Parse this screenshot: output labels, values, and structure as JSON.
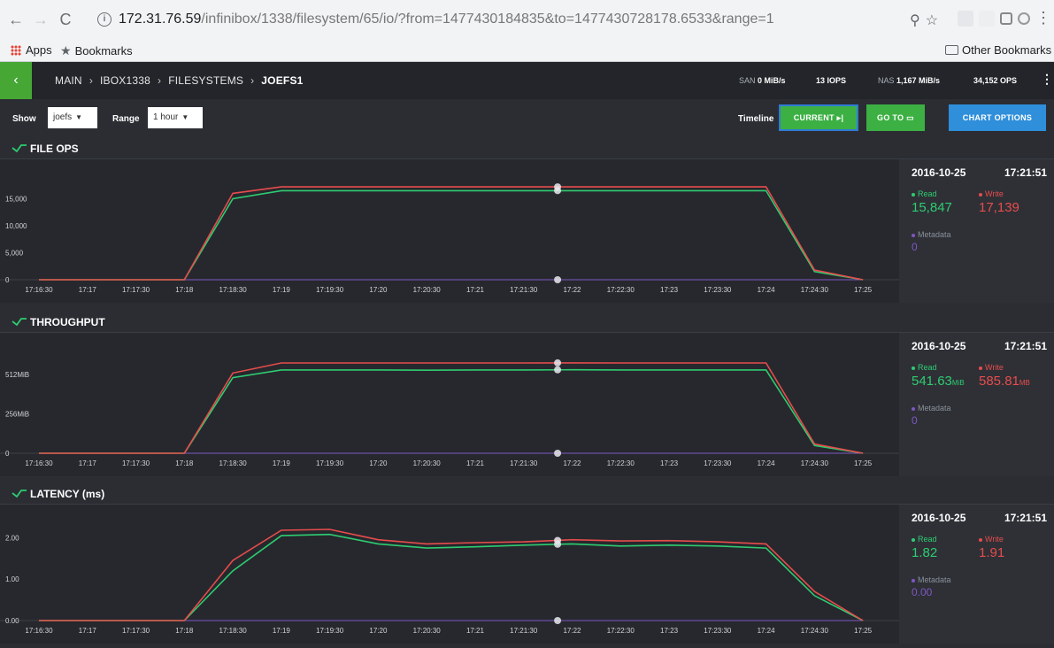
{
  "browser": {
    "url_host": "172.31.76.59",
    "url_path": "/infinibox/1338/filesystem/65/io/?from=1477430184835&to=1477430728178.6533&range=1",
    "bookmarks": {
      "apps": "Apps",
      "bookmarks": "Bookmarks",
      "other": "Other Bookmarks"
    }
  },
  "header": {
    "breadcrumb": [
      "MAIN",
      "IBOX1338",
      "FILESYSTEMS",
      "JOEFS1"
    ],
    "san_label": "SAN",
    "san_value": "0 MiB/s",
    "san_iops": "13 IOPS",
    "nas_label": "NAS",
    "nas_value": "1,167 MiB/s",
    "nas_ops": "34,152 OPS"
  },
  "toolbar": {
    "show_label": "Show",
    "show_value": "joefs",
    "range_label": "Range",
    "range_value": "1 hour",
    "timeline_label": "Timeline",
    "current_label": "CURRENT",
    "goto_label": "GO TO",
    "chart_options_label": "CHART OPTIONS"
  },
  "colors": {
    "read": "#2ecc71",
    "write": "#e74c4c",
    "metadata": "#7e57c2"
  },
  "x_ticks": [
    "17:16:30",
    "17:17",
    "17:17:30",
    "17:18",
    "17:18:30",
    "17:19",
    "17:19:30",
    "17:20",
    "17:20:30",
    "17:21",
    "17:21:30",
    "17:22",
    "17:22:30",
    "17:23",
    "17:23:30",
    "17:24",
    "17:24:30",
    "17:25"
  ],
  "panels": [
    {
      "title": "FILE OPS",
      "date": "2016-10-25",
      "time": "17:21:51",
      "read_label": "Read",
      "write_label": "Write",
      "metadata_label": "Metadata",
      "read_value": "15,847",
      "read_unit": "",
      "write_value": "17,139",
      "write_unit": "",
      "metadata_value": "0",
      "y_tick_labels": [
        "0",
        "5,000",
        "10,000",
        "15,000"
      ]
    },
    {
      "title": "THROUGHPUT",
      "date": "2016-10-25",
      "time": "17:21:51",
      "read_label": "Read",
      "write_label": "Write",
      "metadata_label": "Metadata",
      "read_value": "541.63",
      "read_unit": "MiB",
      "write_value": "585.81",
      "write_unit": "MB",
      "metadata_value": "0",
      "y_tick_labels": [
        "0",
        "256MiB",
        "512MiB"
      ]
    },
    {
      "title": "LATENCY (ms)",
      "date": "2016-10-25",
      "time": "17:21:51",
      "read_label": "Read",
      "write_label": "Write",
      "metadata_label": "Metadata",
      "read_value": "1.82",
      "read_unit": "",
      "write_value": "1.91",
      "write_unit": "",
      "metadata_value": "0.00",
      "y_tick_labels": [
        "0.00",
        "1.00",
        "2.00"
      ]
    }
  ],
  "chart_data": [
    {
      "type": "line",
      "title": "FILE OPS",
      "x": [
        "17:16:30",
        "17:17",
        "17:17:30",
        "17:18",
        "17:18:30",
        "17:19",
        "17:19:30",
        "17:20",
        "17:20:30",
        "17:21",
        "17:21:30",
        "17:22",
        "17:22:30",
        "17:23",
        "17:23:30",
        "17:24",
        "17:24:30",
        "17:25"
      ],
      "ylim": [
        0,
        20000
      ],
      "series": [
        {
          "name": "Read",
          "values": [
            0,
            0,
            0,
            0,
            15000,
            16500,
            16500,
            16500,
            16500,
            16500,
            16500,
            16500,
            16500,
            16500,
            16500,
            16500,
            1500,
            0
          ]
        },
        {
          "name": "Write",
          "values": [
            0,
            0,
            0,
            0,
            16000,
            17200,
            17200,
            17200,
            17200,
            17200,
            17200,
            17200,
            17200,
            17200,
            17200,
            17200,
            1800,
            0
          ]
        },
        {
          "name": "Metadata",
          "values": [
            0,
            0,
            0,
            0,
            0,
            0,
            0,
            0,
            0,
            0,
            0,
            0,
            0,
            0,
            0,
            0,
            0,
            0
          ]
        }
      ]
    },
    {
      "type": "line",
      "title": "THROUGHPUT",
      "x": [
        "17:16:30",
        "17:17",
        "17:17:30",
        "17:18",
        "17:18:30",
        "17:19",
        "17:19:30",
        "17:20",
        "17:20:30",
        "17:21",
        "17:21:30",
        "17:22",
        "17:22:30",
        "17:23",
        "17:23:30",
        "17:24",
        "17:24:30",
        "17:25"
      ],
      "ylim": [
        0,
        700
      ],
      "series": [
        {
          "name": "Read",
          "values": [
            0,
            0,
            0,
            0,
            490,
            540,
            540,
            540,
            538,
            540,
            540,
            541,
            540,
            540,
            540,
            540,
            50,
            0
          ]
        },
        {
          "name": "Write",
          "values": [
            0,
            0,
            0,
            0,
            520,
            585,
            585,
            585,
            585,
            585,
            585,
            586,
            585,
            585,
            585,
            585,
            60,
            0
          ]
        },
        {
          "name": "Metadata",
          "values": [
            0,
            0,
            0,
            0,
            0,
            0,
            0,
            0,
            0,
            0,
            0,
            0,
            0,
            0,
            0,
            0,
            0,
            0
          ]
        }
      ]
    },
    {
      "type": "line",
      "title": "LATENCY (ms)",
      "x": [
        "17:16:30",
        "17:17",
        "17:17:30",
        "17:18",
        "17:18:30",
        "17:19",
        "17:19:30",
        "17:20",
        "17:20:30",
        "17:21",
        "17:21:30",
        "17:22",
        "17:22:30",
        "17:23",
        "17:23:30",
        "17:24",
        "17:24:30",
        "17:25"
      ],
      "ylim": [
        0,
        2.5
      ],
      "series": [
        {
          "name": "Read",
          "values": [
            0,
            0,
            0,
            0,
            1.2,
            2.05,
            2.08,
            1.85,
            1.75,
            1.78,
            1.82,
            1.85,
            1.8,
            1.82,
            1.8,
            1.75,
            0.6,
            0
          ]
        },
        {
          "name": "Write",
          "values": [
            0,
            0,
            0,
            0,
            1.45,
            2.18,
            2.2,
            1.95,
            1.85,
            1.88,
            1.9,
            1.95,
            1.92,
            1.93,
            1.9,
            1.85,
            0.7,
            0
          ]
        },
        {
          "name": "Metadata",
          "values": [
            0,
            0,
            0,
            0,
            0,
            0,
            0,
            0,
            0,
            0,
            0,
            0,
            0,
            0,
            0,
            0,
            0,
            0
          ]
        }
      ]
    }
  ]
}
